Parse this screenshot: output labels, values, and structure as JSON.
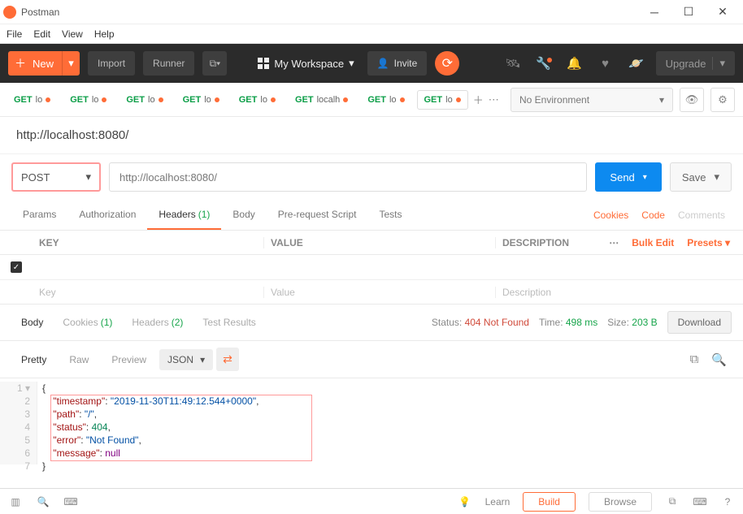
{
  "window": {
    "title": "Postman"
  },
  "menu": [
    "File",
    "Edit",
    "View",
    "Help"
  ],
  "toolbar": {
    "new_label": "New",
    "import_label": "Import",
    "runner_label": "Runner",
    "workspace_label": "My Workspace",
    "invite_label": "Invite",
    "upgrade_label": "Upgrade"
  },
  "tabs": [
    {
      "method": "GET",
      "label": "lo"
    },
    {
      "method": "GET",
      "label": "lo"
    },
    {
      "method": "GET",
      "label": "lo"
    },
    {
      "method": "GET",
      "label": "lo"
    },
    {
      "method": "GET",
      "label": "lo"
    },
    {
      "method": "GET",
      "label": "localh"
    },
    {
      "method": "GET",
      "label": "lo"
    },
    {
      "method": "GET",
      "label": "lo"
    }
  ],
  "environment": {
    "selected": "No Environment"
  },
  "request": {
    "title": "http://localhost:8080/",
    "method": "POST",
    "url": "http://localhost:8080/",
    "send_label": "Send",
    "save_label": "Save",
    "tabs": {
      "params": "Params",
      "auth": "Authorization",
      "headers": "Headers",
      "headers_count": "(1)",
      "body": "Body",
      "prescript": "Pre-request Script",
      "tests": "Tests"
    },
    "links": {
      "cookies": "Cookies",
      "code": "Code",
      "comments": "Comments"
    },
    "header_table": {
      "key_h": "KEY",
      "val_h": "VALUE",
      "desc_h": "DESCRIPTION",
      "bulk": "Bulk Edit",
      "presets": "Presets",
      "key_ph": "Key",
      "val_ph": "Value",
      "desc_ph": "Description"
    }
  },
  "response": {
    "tabs": {
      "body": "Body",
      "cookies": "Cookies",
      "cookies_count": "(1)",
      "headers": "Headers",
      "headers_count": "(2)",
      "tests": "Test Results"
    },
    "status_label": "Status:",
    "status_value": "404 Not Found",
    "time_label": "Time:",
    "time_value": "498 ms",
    "size_label": "Size:",
    "size_value": "203 B",
    "download": "Download",
    "pretty": "Pretty",
    "raw": "Raw",
    "preview": "Preview",
    "format": "JSON",
    "body_lines": [
      "{",
      "    \"timestamp\": \"2019-11-30T11:49:12.544+0000\",",
      "    \"path\": \"/\",",
      "    \"status\": 404,",
      "    \"error\": \"Not Found\",",
      "    \"message\": null",
      "}"
    ]
  },
  "statusbar": {
    "learn": "Learn",
    "build": "Build",
    "browse": "Browse"
  }
}
